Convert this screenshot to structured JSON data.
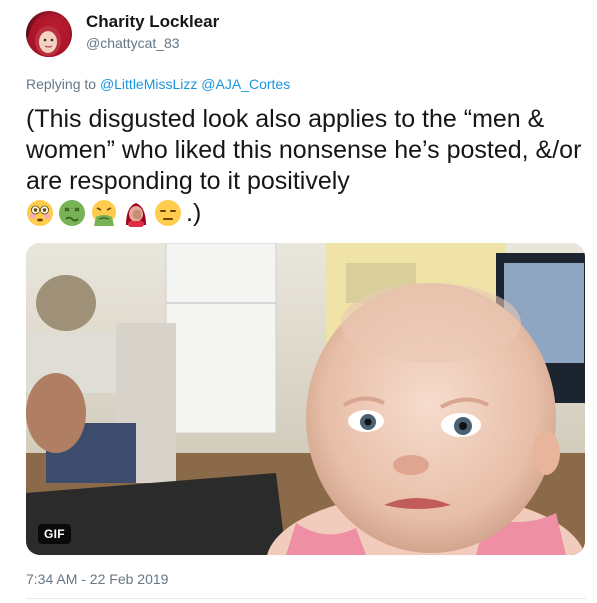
{
  "author": {
    "display_name": "Charity Locklear",
    "handle": "@chattycat_83"
  },
  "reply": {
    "prefix": "Replying to",
    "mentions": [
      "@LittleMissLizz",
      "@AJA_Cortes"
    ]
  },
  "tweet": {
    "text_line": "(This disgusted look also applies to the “men & women” who liked this nonsense he’s posted, &/or are responding to it positively",
    "closing": ".)",
    "emojis": [
      "flushed-face-icon",
      "nauseated-face-icon",
      "vomiting-face-icon",
      "woman-facepalming-icon",
      "expressionless-face-icon"
    ]
  },
  "media": {
    "badge": "GIF",
    "icon": "baby-gif-image"
  },
  "meta": {
    "timestamp": "7:34 AM - 22 Feb 2019"
  },
  "colors": {
    "link": "#1b95e0",
    "secondary_text": "#657786",
    "primary_text": "#14171a"
  }
}
